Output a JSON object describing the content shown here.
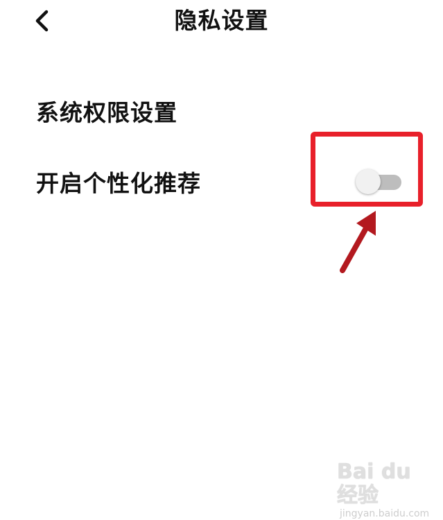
{
  "header": {
    "title": "隐私设置",
    "back_icon": "chevron-left-icon"
  },
  "settings": [
    {
      "label": "系统权限设置"
    },
    {
      "label": "开启个性化推荐",
      "toggle_on": false
    }
  ],
  "annotation": {
    "highlight_color": "#e8202a",
    "arrow_color": "#b3191f"
  },
  "watermark": {
    "logo": "Bai du 经验",
    "url": "jingyan.baidu.com"
  }
}
